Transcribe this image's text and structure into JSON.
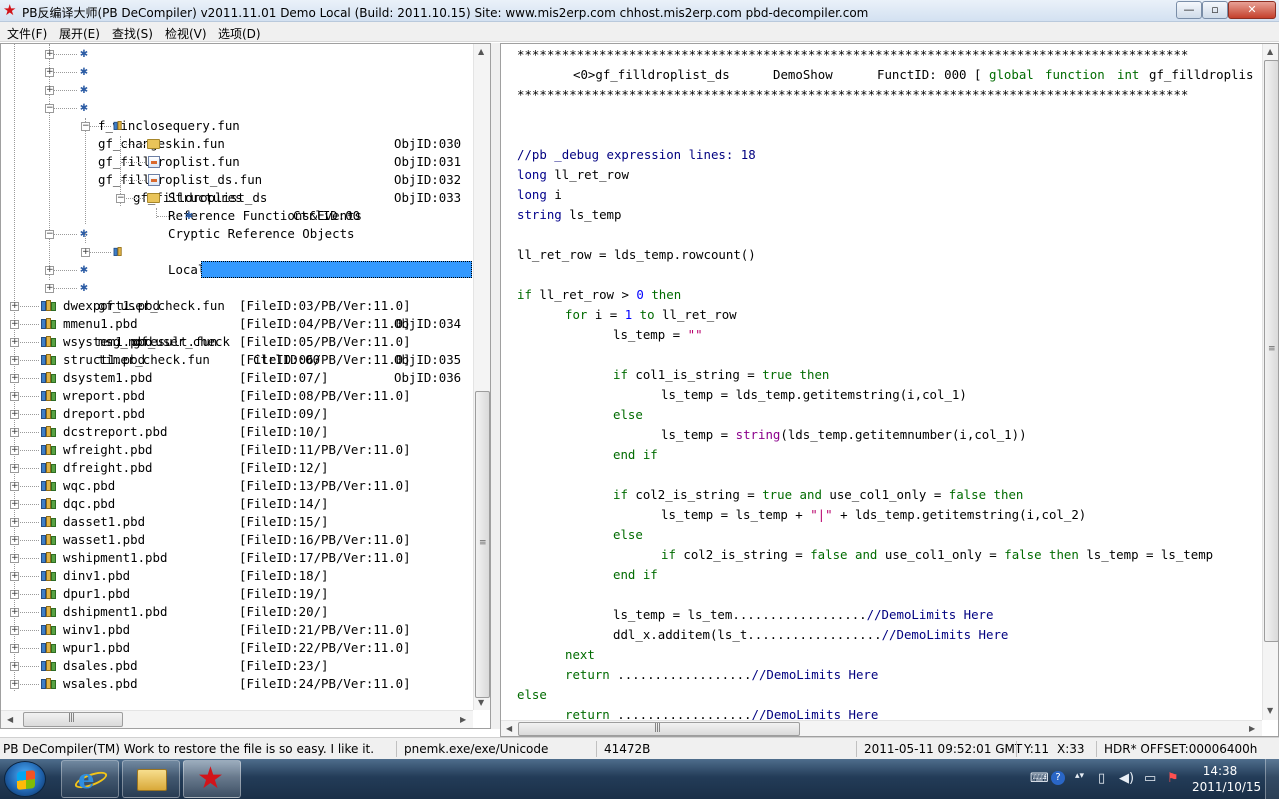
{
  "window": {
    "title": "PB反编译大师(PB DeCompiler) v2011.11.01 Demo Local (Build: 2011.10.15)  Site: www.mis2erp.com  chhost.mis2erp.com pbd-decompiler.com",
    "min_glyph": "—",
    "max_glyph": "▫",
    "close_glyph": "✕"
  },
  "menu": [
    "文件(F)",
    "展开(E)",
    "查找(S)",
    "检视(V)",
    "选项(D)"
  ],
  "tree": {
    "fun_nodes_top": [
      {
        "name": "f_winclosequery.fun",
        "id": "ObjID:030"
      },
      {
        "name": "gf_changeskin.fun",
        "id": "ObjID:031"
      },
      {
        "name": "gf_filldroplist.fun",
        "id": "ObjID:032"
      },
      {
        "name": "gf_filldroplist_ds.fun",
        "id": "ObjID:033"
      }
    ],
    "ds_node": {
      "name": "gf_filldroplist_ds",
      "ctrl": "CtrlID:00"
    },
    "ds_children": [
      "Structures",
      "Reference Functions&Events",
      "Cryptic Reference Objects",
      "Local Functions"
    ],
    "selected": {
      "name": "gf_filldroplist_ds",
      "tag": "DemoShow"
    },
    "fun_nodes_bottom": [
      {
        "name": "gf_user_check.fun",
        "id": "ObjID:034"
      },
      {
        "name": "msg_noresult.fun",
        "id": "ObjID:035"
      },
      {
        "name": "timer_check.fun",
        "id": "ObjID:036"
      }
    ],
    "user_check_node": {
      "name": "gf_user_check",
      "ctrl": "CtrlID:00"
    },
    "pbds": [
      {
        "name": "dwexport1.pbd",
        "info": "[FileID:03/PB/Ver:11.0]"
      },
      {
        "name": "mmenu1.pbd",
        "info": "[FileID:04/PB/Ver:11.0]"
      },
      {
        "name": "wsystem1.pbd",
        "info": "[FileID:05/PB/Ver:11.0]"
      },
      {
        "name": "struct1.pbd",
        "info": "[FileID:06/PB/Ver:11.0]"
      },
      {
        "name": "dsystem1.pbd",
        "info": "[FileID:07/]"
      },
      {
        "name": "wreport.pbd",
        "info": "[FileID:08/PB/Ver:11.0]"
      },
      {
        "name": "dreport.pbd",
        "info": "[FileID:09/]"
      },
      {
        "name": "dcstreport.pbd",
        "info": "[FileID:10/]"
      },
      {
        "name": "wfreight.pbd",
        "info": "[FileID:11/PB/Ver:11.0]"
      },
      {
        "name": "dfreight.pbd",
        "info": "[FileID:12/]"
      },
      {
        "name": "wqc.pbd",
        "info": "[FileID:13/PB/Ver:11.0]"
      },
      {
        "name": "dqc.pbd",
        "info": "[FileID:14/]"
      },
      {
        "name": "dasset1.pbd",
        "info": "[FileID:15/]"
      },
      {
        "name": "wasset1.pbd",
        "info": "[FileID:16/PB/Ver:11.0]"
      },
      {
        "name": "wshipment1.pbd",
        "info": "[FileID:17/PB/Ver:11.0]"
      },
      {
        "name": "dinv1.pbd",
        "info": "[FileID:18/]"
      },
      {
        "name": "dpur1.pbd",
        "info": "[FileID:19/]"
      },
      {
        "name": "dshipment1.pbd",
        "info": "[FileID:20/]"
      },
      {
        "name": "winv1.pbd",
        "info": "[FileID:21/PB/Ver:11.0]"
      },
      {
        "name": "wpur1.pbd",
        "info": "[FileID:22/PB/Ver:11.0]"
      },
      {
        "name": "dsales.pbd",
        "info": "[FileID:23/]"
      },
      {
        "name": "wsales.pbd",
        "info": "[FileID:24/PB/Ver:11.0]"
      }
    ]
  },
  "code": {
    "stars": "******************************************************************************************",
    "header": {
      "obj": "<0>gf_filldroplist_ds",
      "demo": "DemoShow",
      "funct": "FunctID: 000 [",
      "kw1": "global",
      "kw2": "function",
      "kw3": "int",
      "rest": "gf_filldroplis"
    },
    "comment_debug": "//pb _debug expression lines: 18",
    "decl": [
      {
        "type": "long",
        "var": "ll_ret_row"
      },
      {
        "type": "long",
        "var": "i"
      },
      {
        "type": "string",
        "var": "ls_temp"
      }
    ],
    "assign_rowcount": "ll_ret_row = lds_temp.rowcount()",
    "kw_if": "if",
    "kw_then": "then",
    "kw_for": "for",
    "kw_to": "to",
    "kw_else": "else",
    "kw_endif": "end if",
    "kw_next": "next",
    "kw_return": "return",
    "kw_true": "true",
    "kw_false": "false",
    "kw_and": "and",
    "if_cond": "ll_ret_row >",
    "zero": "0",
    "one": "1",
    "for_var": "i =",
    "for_end": "ll_ret_row",
    "ls_init": "ls_temp =",
    "empty_str": "\"\"",
    "if1_cond": "col1_is_string =",
    "assign_getstr": "ls_temp = lds_temp.getitemstring(i,col_1)",
    "assign_string_lhs": "ls_temp =",
    "fn_string": "string",
    "assign_string_arg": "(lds_temp.getitemnumber(i,col_1))",
    "if2_cond_a": "col2_is_string =",
    "if2_cond_b": "use_col1_only =",
    "assign_concat_a": "ls_temp = ls_temp +",
    "pipe_str": "\"|\"",
    "assign_concat_b": "+ lds_temp.getitemstring(i,col_2)",
    "if3_cond_a": "col2_is_string =",
    "if3_cond_b": "use_col1_only =",
    "if3_tail": "ls_temp = ls_temp",
    "limit_line1": "ls_temp = ls_tem..................",
    "limit_line2": "ddl_x.additem(ls_t..................",
    "limit_return": "..................",
    "demo_limits": "//DemoLimits Here"
  },
  "status": {
    "app": "PB DeCompiler(TM)  Work to restore the file is so easy. I like it.",
    "file": "pnemk.exe/exe/Unicode",
    "size": "41472B",
    "date": "2011-05-11 09:52:01 GMT",
    "y": "Y:11",
    "x": "X:33",
    "hdr": "HDR* OFFSET:00006400h"
  },
  "taskbar": {
    "time": "14:38",
    "date": "2011/10/15",
    "ie_glyph": "e",
    "pb_glyph": "★",
    "tray_icons": [
      "keyboard-icon",
      "help-icon",
      "network-icon",
      "device-icon",
      "volume-icon",
      "action-center-icon",
      "flag-icon"
    ]
  },
  "colors": {
    "selection": "#3399ff",
    "keyword": "#006b00",
    "number": "#0000ff",
    "function": "#8b008b",
    "comment": "#000080"
  }
}
